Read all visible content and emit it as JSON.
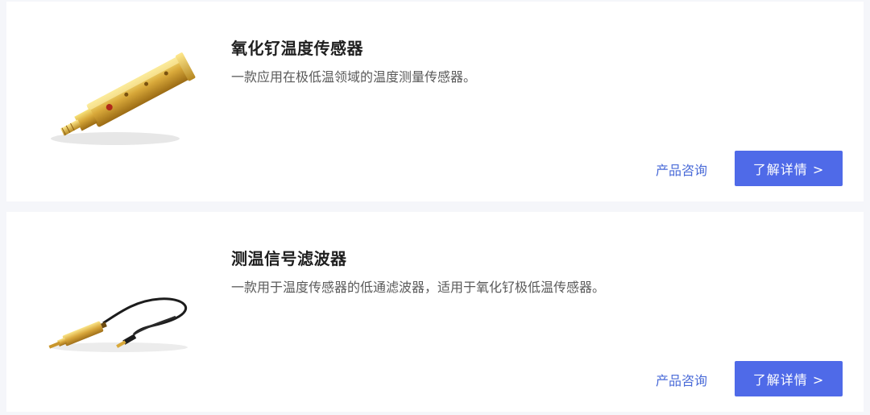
{
  "products": [
    {
      "title": "氧化钌温度传感器",
      "description": "一款应用在极低温领域的温度测量传感器。",
      "consult_label": "产品咨询",
      "details_label": "了解详情 >",
      "image_icon": "gold-sensor-image"
    },
    {
      "title": "测温信号滤波器",
      "description": "一款用于温度传感器的低通滤波器，适用于氧化钌极低温传感器。",
      "consult_label": "产品咨询",
      "details_label": "了解详情 >",
      "image_icon": "filter-cable-image"
    }
  ],
  "colors": {
    "accent": "#4f6ae8",
    "link": "#4a6bd8",
    "background": "#f5f6fa",
    "card": "#ffffff"
  }
}
